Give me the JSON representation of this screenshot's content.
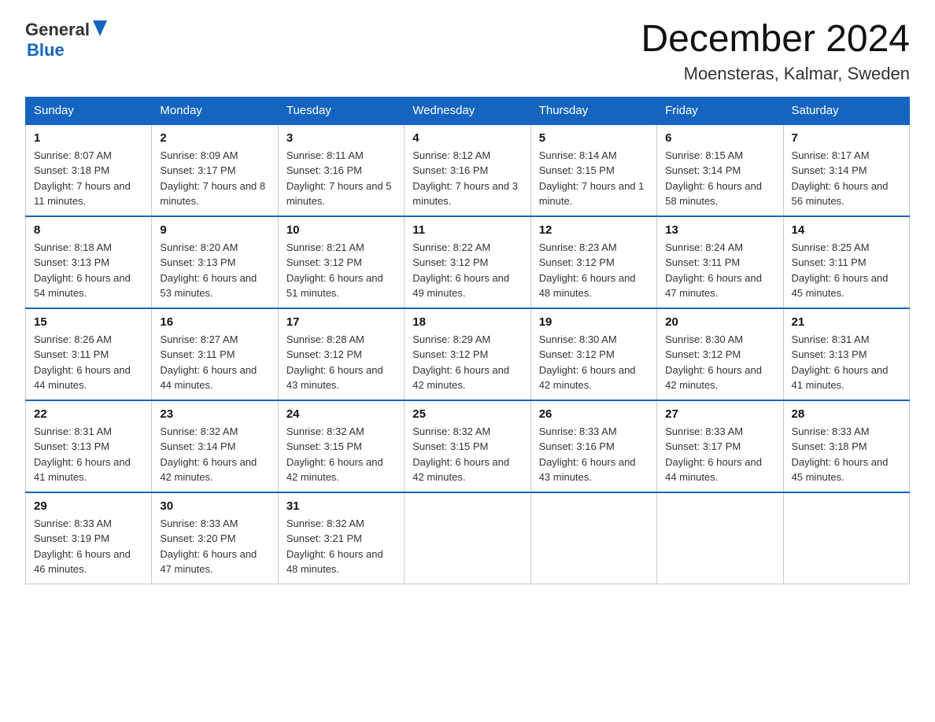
{
  "logo": {
    "general": "General",
    "blue": "Blue"
  },
  "title": "December 2024",
  "subtitle": "Moensteras, Kalmar, Sweden",
  "headers": [
    "Sunday",
    "Monday",
    "Tuesday",
    "Wednesday",
    "Thursday",
    "Friday",
    "Saturday"
  ],
  "weeks": [
    [
      {
        "day": "1",
        "sunrise": "8:07 AM",
        "sunset": "3:18 PM",
        "daylight": "7 hours and 11 minutes."
      },
      {
        "day": "2",
        "sunrise": "8:09 AM",
        "sunset": "3:17 PM",
        "daylight": "7 hours and 8 minutes."
      },
      {
        "day": "3",
        "sunrise": "8:11 AM",
        "sunset": "3:16 PM",
        "daylight": "7 hours and 5 minutes."
      },
      {
        "day": "4",
        "sunrise": "8:12 AM",
        "sunset": "3:16 PM",
        "daylight": "7 hours and 3 minutes."
      },
      {
        "day": "5",
        "sunrise": "8:14 AM",
        "sunset": "3:15 PM",
        "daylight": "7 hours and 1 minute."
      },
      {
        "day": "6",
        "sunrise": "8:15 AM",
        "sunset": "3:14 PM",
        "daylight": "6 hours and 58 minutes."
      },
      {
        "day": "7",
        "sunrise": "8:17 AM",
        "sunset": "3:14 PM",
        "daylight": "6 hours and 56 minutes."
      }
    ],
    [
      {
        "day": "8",
        "sunrise": "8:18 AM",
        "sunset": "3:13 PM",
        "daylight": "6 hours and 54 minutes."
      },
      {
        "day": "9",
        "sunrise": "8:20 AM",
        "sunset": "3:13 PM",
        "daylight": "6 hours and 53 minutes."
      },
      {
        "day": "10",
        "sunrise": "8:21 AM",
        "sunset": "3:12 PM",
        "daylight": "6 hours and 51 minutes."
      },
      {
        "day": "11",
        "sunrise": "8:22 AM",
        "sunset": "3:12 PM",
        "daylight": "6 hours and 49 minutes."
      },
      {
        "day": "12",
        "sunrise": "8:23 AM",
        "sunset": "3:12 PM",
        "daylight": "6 hours and 48 minutes."
      },
      {
        "day": "13",
        "sunrise": "8:24 AM",
        "sunset": "3:11 PM",
        "daylight": "6 hours and 47 minutes."
      },
      {
        "day": "14",
        "sunrise": "8:25 AM",
        "sunset": "3:11 PM",
        "daylight": "6 hours and 45 minutes."
      }
    ],
    [
      {
        "day": "15",
        "sunrise": "8:26 AM",
        "sunset": "3:11 PM",
        "daylight": "6 hours and 44 minutes."
      },
      {
        "day": "16",
        "sunrise": "8:27 AM",
        "sunset": "3:11 PM",
        "daylight": "6 hours and 44 minutes."
      },
      {
        "day": "17",
        "sunrise": "8:28 AM",
        "sunset": "3:12 PM",
        "daylight": "6 hours and 43 minutes."
      },
      {
        "day": "18",
        "sunrise": "8:29 AM",
        "sunset": "3:12 PM",
        "daylight": "6 hours and 42 minutes."
      },
      {
        "day": "19",
        "sunrise": "8:30 AM",
        "sunset": "3:12 PM",
        "daylight": "6 hours and 42 minutes."
      },
      {
        "day": "20",
        "sunrise": "8:30 AM",
        "sunset": "3:12 PM",
        "daylight": "6 hours and 42 minutes."
      },
      {
        "day": "21",
        "sunrise": "8:31 AM",
        "sunset": "3:13 PM",
        "daylight": "6 hours and 41 minutes."
      }
    ],
    [
      {
        "day": "22",
        "sunrise": "8:31 AM",
        "sunset": "3:13 PM",
        "daylight": "6 hours and 41 minutes."
      },
      {
        "day": "23",
        "sunrise": "8:32 AM",
        "sunset": "3:14 PM",
        "daylight": "6 hours and 42 minutes."
      },
      {
        "day": "24",
        "sunrise": "8:32 AM",
        "sunset": "3:15 PM",
        "daylight": "6 hours and 42 minutes."
      },
      {
        "day": "25",
        "sunrise": "8:32 AM",
        "sunset": "3:15 PM",
        "daylight": "6 hours and 42 minutes."
      },
      {
        "day": "26",
        "sunrise": "8:33 AM",
        "sunset": "3:16 PM",
        "daylight": "6 hours and 43 minutes."
      },
      {
        "day": "27",
        "sunrise": "8:33 AM",
        "sunset": "3:17 PM",
        "daylight": "6 hours and 44 minutes."
      },
      {
        "day": "28",
        "sunrise": "8:33 AM",
        "sunset": "3:18 PM",
        "daylight": "6 hours and 45 minutes."
      }
    ],
    [
      {
        "day": "29",
        "sunrise": "8:33 AM",
        "sunset": "3:19 PM",
        "daylight": "6 hours and 46 minutes."
      },
      {
        "day": "30",
        "sunrise": "8:33 AM",
        "sunset": "3:20 PM",
        "daylight": "6 hours and 47 minutes."
      },
      {
        "day": "31",
        "sunrise": "8:32 AM",
        "sunset": "3:21 PM",
        "daylight": "6 hours and 48 minutes."
      },
      null,
      null,
      null,
      null
    ]
  ]
}
